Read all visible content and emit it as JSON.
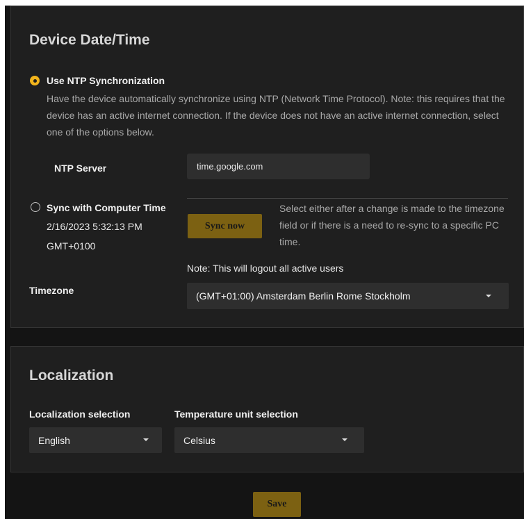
{
  "device_datetime": {
    "title": "Device Date/Time",
    "ntp": {
      "label": "Use NTP Synchronization",
      "description": "Have the device automatically synchronize using NTP (Network Time Protocol). Note: this requires that the device has an active internet connection. If the device does not have an active internet connection, select one of the options below.",
      "selected": true,
      "server_label": "NTP Server",
      "server_value": "time.google.com"
    },
    "computer_time": {
      "label": "Sync with Computer Time",
      "date": "2/16/2023 5:32:13 PM",
      "tz": "GMT+0100",
      "selected": false,
      "button_label": "Sync now",
      "help": "Select either after a change is made to the timezone field or if there is a need to re-sync to a specific PC time.",
      "note": "Note: This will logout all active users"
    },
    "timezone": {
      "label": "Timezone",
      "value": "(GMT+01:00) Amsterdam Berlin Rome Stockholm"
    }
  },
  "localization": {
    "title": "Localization",
    "localization_selection": {
      "label": "Localization selection",
      "value": "English"
    },
    "temperature_unit": {
      "label": "Temperature unit selection",
      "value": "Celsius"
    }
  },
  "actions": {
    "save_label": "Save"
  },
  "colors": {
    "accent": "#f2b41c",
    "button_bg": "#7c6112",
    "panel_bg": "#1f1f1f",
    "page_bg": "#141414"
  }
}
